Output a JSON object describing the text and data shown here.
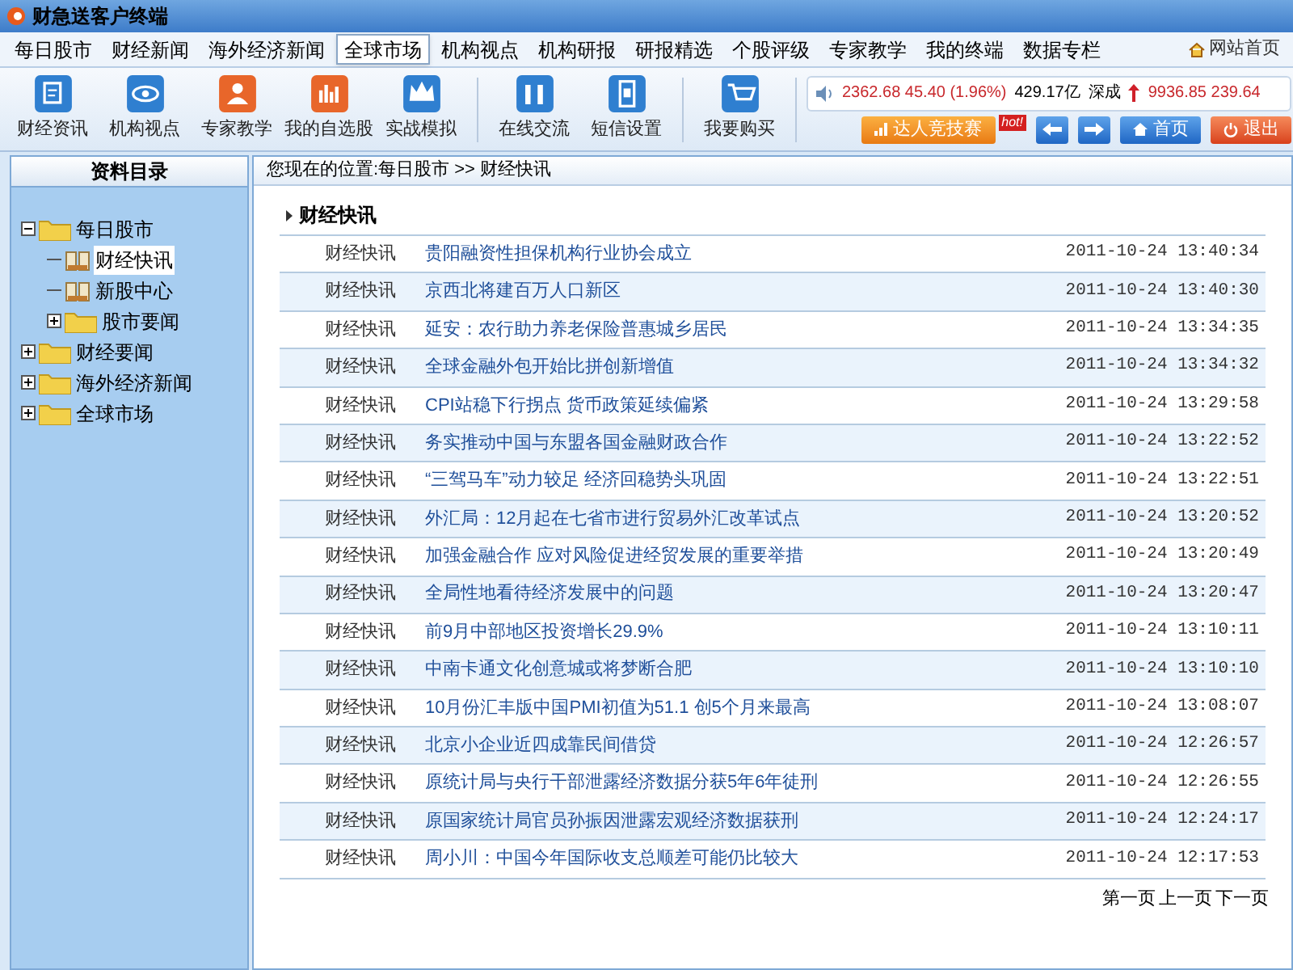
{
  "window": {
    "title": "财急送客户终端"
  },
  "site_link": "网站首页",
  "nav": [
    {
      "label": "每日股市",
      "selected": false
    },
    {
      "label": "财经新闻",
      "selected": false
    },
    {
      "label": "海外经济新闻",
      "selected": false
    },
    {
      "label": "全球市场",
      "selected": true
    },
    {
      "label": "机构视点",
      "selected": false
    },
    {
      "label": "机构研报",
      "selected": false
    },
    {
      "label": "研报精选",
      "selected": false
    },
    {
      "label": "个股评级",
      "selected": false
    },
    {
      "label": "专家教学",
      "selected": false
    },
    {
      "label": "我的终端",
      "selected": false
    },
    {
      "label": "数据专栏",
      "selected": false
    }
  ],
  "toolbar": [
    {
      "label": "财经资讯",
      "color": "#2f7fd0",
      "separator_before": false
    },
    {
      "label": "机构视点",
      "color": "#2f7fd0",
      "separator_before": false
    },
    {
      "label": "专家教学",
      "color": "#e8662a",
      "separator_before": false
    },
    {
      "label": "我的自选股",
      "color": "#e8662a",
      "separator_before": false
    },
    {
      "label": "实战模拟",
      "color": "#2f7fd0",
      "separator_before": false
    },
    {
      "label": "在线交流",
      "color": "#2f7fd0",
      "separator_before": true
    },
    {
      "label": "短信设置",
      "color": "#2f7fd0",
      "separator_before": false
    },
    {
      "label": "我要购买",
      "color": "#2f7fd0",
      "separator_before": true
    }
  ],
  "ticker": {
    "index_value": "2362.68 45.40 (1.96%)",
    "turnover": "429.17亿",
    "label": "深成",
    "sz_value": "9936.85 239.64"
  },
  "actions": {
    "contest": "达人竞技赛",
    "hot": "hot!",
    "home": "首页",
    "exit": "退出"
  },
  "sidebar": {
    "title": "资料目录",
    "tree": [
      {
        "label": "每日股市",
        "kind": "folder",
        "expanded": true,
        "selected": false,
        "children": [
          {
            "label": "财经快讯",
            "kind": "page",
            "selected": true
          },
          {
            "label": "新股中心",
            "kind": "page",
            "selected": false
          },
          {
            "label": "股市要闻",
            "kind": "folder",
            "expanded": false,
            "selected": false
          }
        ]
      },
      {
        "label": "财经要闻",
        "kind": "folder",
        "expanded": false,
        "selected": false
      },
      {
        "label": "海外经济新闻",
        "kind": "folder",
        "expanded": false,
        "selected": false
      },
      {
        "label": "全球市场",
        "kind": "folder",
        "expanded": false,
        "selected": false
      }
    ]
  },
  "breadcrumb": "您现在的位置:每日股市 >> 财经快讯",
  "section_title": "财经快讯",
  "rows": [
    {
      "category": "财经快讯",
      "title": "贵阳融资性担保机构行业协会成立",
      "time": "2011-10-24 13:40:34"
    },
    {
      "category": "财经快讯",
      "title": "京西北将建百万人口新区",
      "time": "2011-10-24 13:40:30"
    },
    {
      "category": "财经快讯",
      "title": "延安：农行助力养老保险普惠城乡居民",
      "time": "2011-10-24 13:34:35"
    },
    {
      "category": "财经快讯",
      "title": "全球金融外包开始比拼创新增值",
      "time": "2011-10-24 13:34:32"
    },
    {
      "category": "财经快讯",
      "title": "CPI站稳下行拐点 货币政策延续偏紧",
      "time": "2011-10-24 13:29:58"
    },
    {
      "category": "财经快讯",
      "title": "务实推动中国与东盟各国金融财政合作",
      "time": "2011-10-24 13:22:52"
    },
    {
      "category": "财经快讯",
      "title": "“三驾马车”动力较足 经济回稳势头巩固",
      "time": "2011-10-24 13:22:51"
    },
    {
      "category": "财经快讯",
      "title": "外汇局：12月起在七省市进行贸易外汇改革试点",
      "time": "2011-10-24 13:20:52"
    },
    {
      "category": "财经快讯",
      "title": "加强金融合作 应对风险促进经贸发展的重要举措",
      "time": "2011-10-24 13:20:49"
    },
    {
      "category": "财经快讯",
      "title": "全局性地看待经济发展中的问题",
      "time": "2011-10-24 13:20:47"
    },
    {
      "category": "财经快讯",
      "title": "前9月中部地区投资增长29.9%",
      "time": "2011-10-24 13:10:11"
    },
    {
      "category": "财经快讯",
      "title": "中南卡通文化创意城或将梦断合肥",
      "time": "2011-10-24 13:10:10"
    },
    {
      "category": "财经快讯",
      "title": "10月份汇丰版中国PMI初值为51.1 创5个月来最高",
      "time": "2011-10-24 13:08:07"
    },
    {
      "category": "财经快讯",
      "title": "北京小企业近四成靠民间借贷",
      "time": "2011-10-24 12:26:57"
    },
    {
      "category": "财经快讯",
      "title": "原统计局与央行干部泄露经济数据分获5年6年徒刑",
      "time": "2011-10-24 12:26:55"
    },
    {
      "category": "财经快讯",
      "title": "原国家统计局官员孙振因泄露宏观经济数据获刑",
      "time": "2011-10-24 12:24:17"
    },
    {
      "category": "财经快讯",
      "title": "周小川：中国今年国际收支总顺差可能仍比较大",
      "time": "2011-10-24 12:17:53"
    }
  ],
  "pagination": [
    "第一页",
    "上一页",
    "下一页"
  ]
}
